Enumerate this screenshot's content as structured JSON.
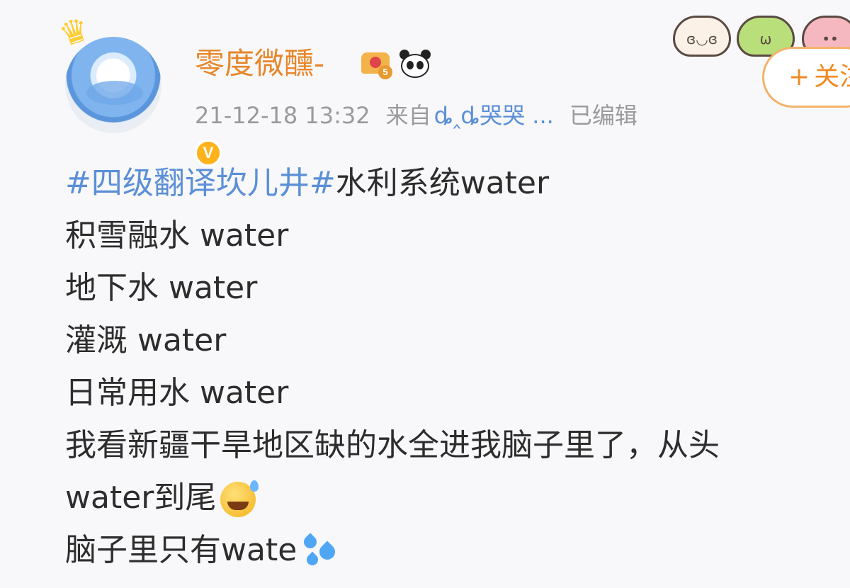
{
  "header": {
    "username": "零度微醺-",
    "vip_level": "5",
    "verified_badge": "V",
    "timestamp": "21-12-18 13:32",
    "source_prefix": "来自",
    "source_app": "ȡ‸ȡ哭哭 ...",
    "edited_label": "已编辑",
    "follow_button": {
      "plus": "+",
      "label": "关注"
    },
    "icons": [
      "crown-icon",
      "vip-crown-badge-icon",
      "panda-icon"
    ]
  },
  "post": {
    "topic": "#四级翻译坎儿井#",
    "lines": [
      "水利系统water",
      "积雪融水  water",
      "地下水 water",
      "灌溉 water",
      "日常用水 water",
      "我看新疆干旱地区缺的水全进我脑子里了，从头",
      "water到尾",
      "脑子里只有wate"
    ],
    "emojis": [
      "grinning-sweat-emoji",
      "sweat-droplets-emoji"
    ]
  },
  "colors": {
    "username": "#e8862a",
    "meta": "#9a9a9e",
    "link": "#5b8fd6",
    "body_text": "#2d2d2d",
    "follow_border": "#f3b26b",
    "follow_text": "#f08a24"
  }
}
